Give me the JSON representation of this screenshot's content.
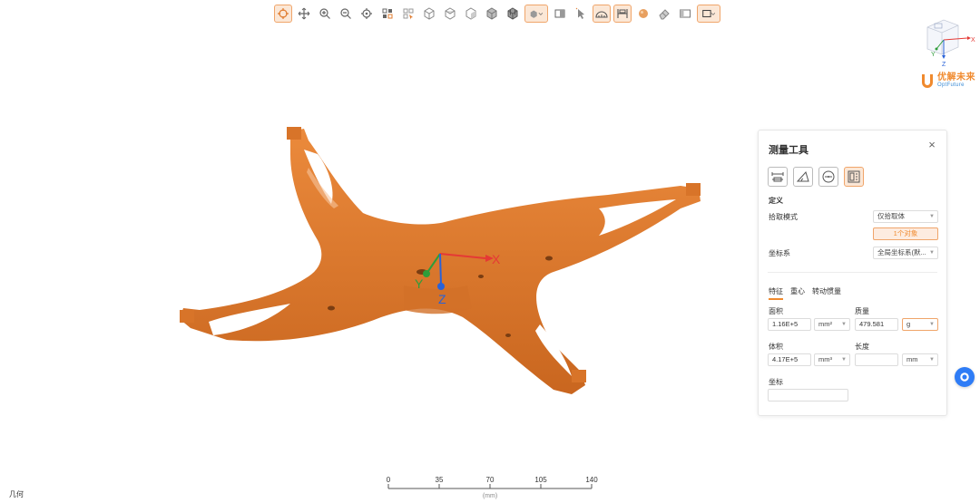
{
  "toolbar": {
    "tools": [
      "orbit-icon",
      "pan-icon",
      "zoom-in-icon",
      "zoom-out-icon",
      "fit-view-icon",
      "select-icon",
      "box-select-icon",
      "view-front-icon",
      "view-top-icon",
      "view-iso-icon",
      "shaded-cube-icon",
      "wireframe-cube-icon",
      "display-mode-icon",
      "section-icon",
      "pointer-icon",
      "measure-angle-icon",
      "measure-tool-icon",
      "material-sphere-icon",
      "eraser-icon",
      "split-view-icon",
      "window-icon"
    ]
  },
  "axis_triad": {
    "x": "X",
    "y": "Y",
    "z": "Z"
  },
  "orientation_cube": {
    "x": "X",
    "y": "Y",
    "z": "Z"
  },
  "logo": {
    "cn": "优解未来",
    "en": "OptFuture"
  },
  "panel": {
    "title": "测量工具",
    "close": "×",
    "section_definition": "定义",
    "pick_mode_label": "拾取模式",
    "pick_mode_value": "仅拾取体",
    "objects_button": "1个对象",
    "coord_label": "坐标系",
    "coord_value": "全局坐标系(默...",
    "tabs": [
      "特征",
      "重心",
      "转动惯量"
    ],
    "area_label": "面积",
    "area_value": "1.16E+5",
    "area_unit": "mm²",
    "mass_label": "质量",
    "mass_value": "479.581",
    "mass_unit": "g",
    "volume_label": "体积",
    "volume_value": "4.17E+5",
    "volume_unit": "mm³",
    "length_label": "长度",
    "length_value": "",
    "length_unit": "mm",
    "coord_field_label": "坐标",
    "coord_field_value": ""
  },
  "ruler": {
    "ticks": [
      "0",
      "35",
      "70",
      "105",
      "140"
    ],
    "unit": "(mm)"
  },
  "status_text": "几何",
  "colors": {
    "accent": "#f08a2e",
    "model": "#e07b2e",
    "x_axis": "#e53935",
    "y_axis": "#2e9d3a",
    "z_axis": "#2962d9"
  }
}
